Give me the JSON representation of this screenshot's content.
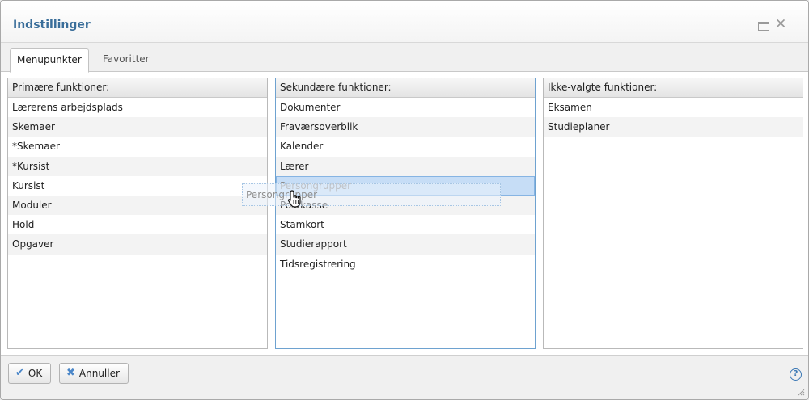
{
  "dialog": {
    "title": "Indstillinger"
  },
  "tabs": [
    {
      "label": "Menupunkter",
      "active": true
    },
    {
      "label": "Favoritter",
      "active": false
    }
  ],
  "panels": {
    "primary": {
      "header": "Primære funktioner:",
      "items": [
        "Lærerens arbejdsplads",
        "Skemaer",
        "*Skemaer",
        "*Kursist",
        "Kursist",
        "Moduler",
        "Hold",
        "Opgaver"
      ]
    },
    "secondary": {
      "header": "Sekundære funktioner:",
      "items": [
        "Dokumenter",
        "Fraværsoverblik",
        "Kalender",
        "Lærer",
        "Persongrupper",
        "Postkasse",
        "Stamkort",
        "Studierapport",
        "Tidsregistrering"
      ],
      "selected_index": 4
    },
    "unselected": {
      "header": "Ikke-valgte funktioner:",
      "items": [
        "Eksamen",
        "Studieplaner"
      ]
    }
  },
  "drag": {
    "ghost_label": "Persongrupper"
  },
  "footer": {
    "ok_label": "OK",
    "cancel_label": "Annuller"
  },
  "colors": {
    "accent": "#3a6e9a",
    "selection": "#c6ddf6",
    "icon_blue": "#4a86c8"
  },
  "icons": {
    "maximize": "maximize-icon",
    "close": "close-icon",
    "ok": "checkmark-icon",
    "cancel": "x-icon",
    "help": "help-icon",
    "cursor": "hand-cursor-icon"
  }
}
